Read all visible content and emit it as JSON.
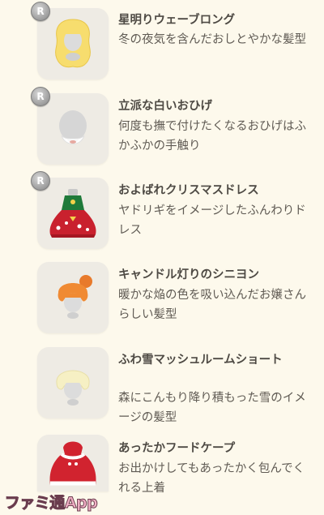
{
  "items": [
    {
      "rank": "R",
      "title": "星明りウェーブロング",
      "desc": "冬の夜気を含んだおしとやかな髪型",
      "icon": "yellow-wavy-hair-icon"
    },
    {
      "rank": "R",
      "title": "立派な白いおひげ",
      "desc": "何度も撫で付けたくなるおひげはふかふかの手触り",
      "icon": "white-beard-icon"
    },
    {
      "rank": "R",
      "title": "およばれクリスマスドレス",
      "desc": "ヤドリギをイメージしたふんわりドレス",
      "icon": "christmas-dress-icon"
    },
    {
      "rank": "",
      "title": "キャンドル灯りのシニヨン",
      "desc": "暖かな焔の色を吸い込んだお嬢さんらしい髪型",
      "icon": "orange-bun-hair-icon"
    },
    {
      "rank": "",
      "title": "ふわ雪マッシュルームショート",
      "desc": "森にこんもり降り積もった雪のイメージの髪型",
      "icon": "cream-mushroom-hair-icon"
    },
    {
      "rank": "",
      "title": "あったかフードケープ",
      "desc": "お出かけしてもあったかく包んでくれる上着",
      "icon": "red-hood-cape-icon"
    }
  ],
  "watermark": {
    "text": "ファミ通App"
  }
}
